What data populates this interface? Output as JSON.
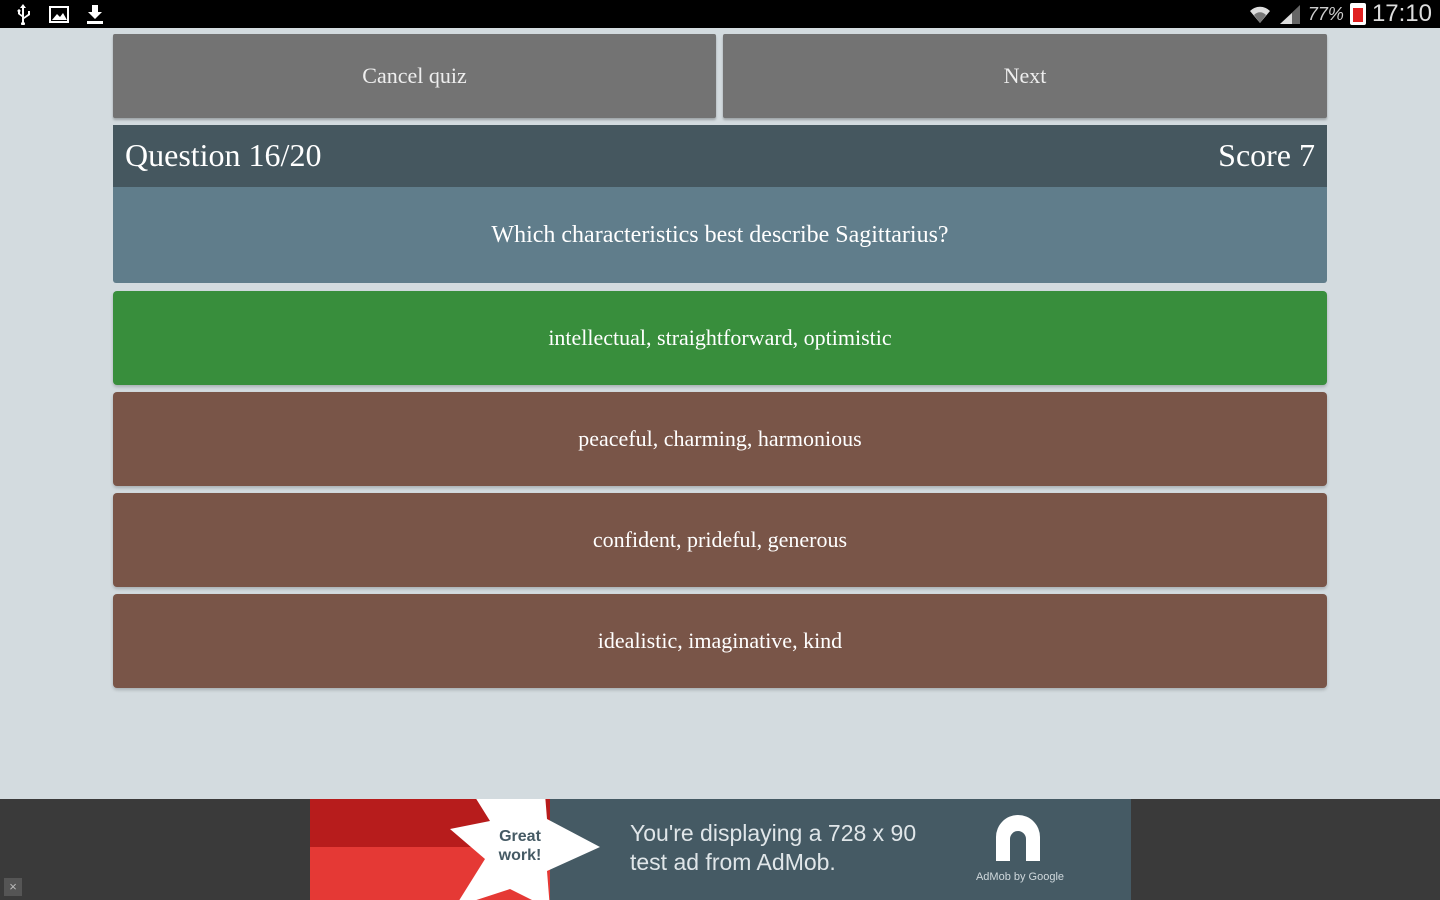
{
  "status_bar": {
    "battery_percent": "77%",
    "time": "17:10",
    "left_icons": [
      "usb-icon",
      "image-icon",
      "download-icon"
    ],
    "right_icons": [
      "wifi-icon",
      "signal-icon",
      "battery-icon"
    ]
  },
  "toolbar": {
    "cancel_label": "Cancel quiz",
    "next_label": "Next"
  },
  "question": {
    "counter": "Question 16/20",
    "score": "Score 7",
    "text": "Which characteristics best describe Sagittarius?"
  },
  "answers": [
    {
      "label": "intellectual, straightforward, optimistic",
      "state": "correct"
    },
    {
      "label": "peaceful, charming, harmonious",
      "state": "neutral"
    },
    {
      "label": "confident, prideful, generous",
      "state": "neutral"
    },
    {
      "label": "idealistic, imaginative, kind",
      "state": "neutral"
    }
  ],
  "ad": {
    "badge_line1": "Great",
    "badge_line2": "work!",
    "line1": "You're displaying a 728 x 90",
    "line2": "test ad from AdMob.",
    "logo_caption": "AdMob by Google",
    "close_label": "×"
  },
  "colors": {
    "background": "#d3dbdf",
    "button_gray": "#737373",
    "header": "#45575f",
    "question_bg": "#607d8b",
    "correct": "#388e3c",
    "neutral": "#795548",
    "ad_bg": "#455a64"
  }
}
